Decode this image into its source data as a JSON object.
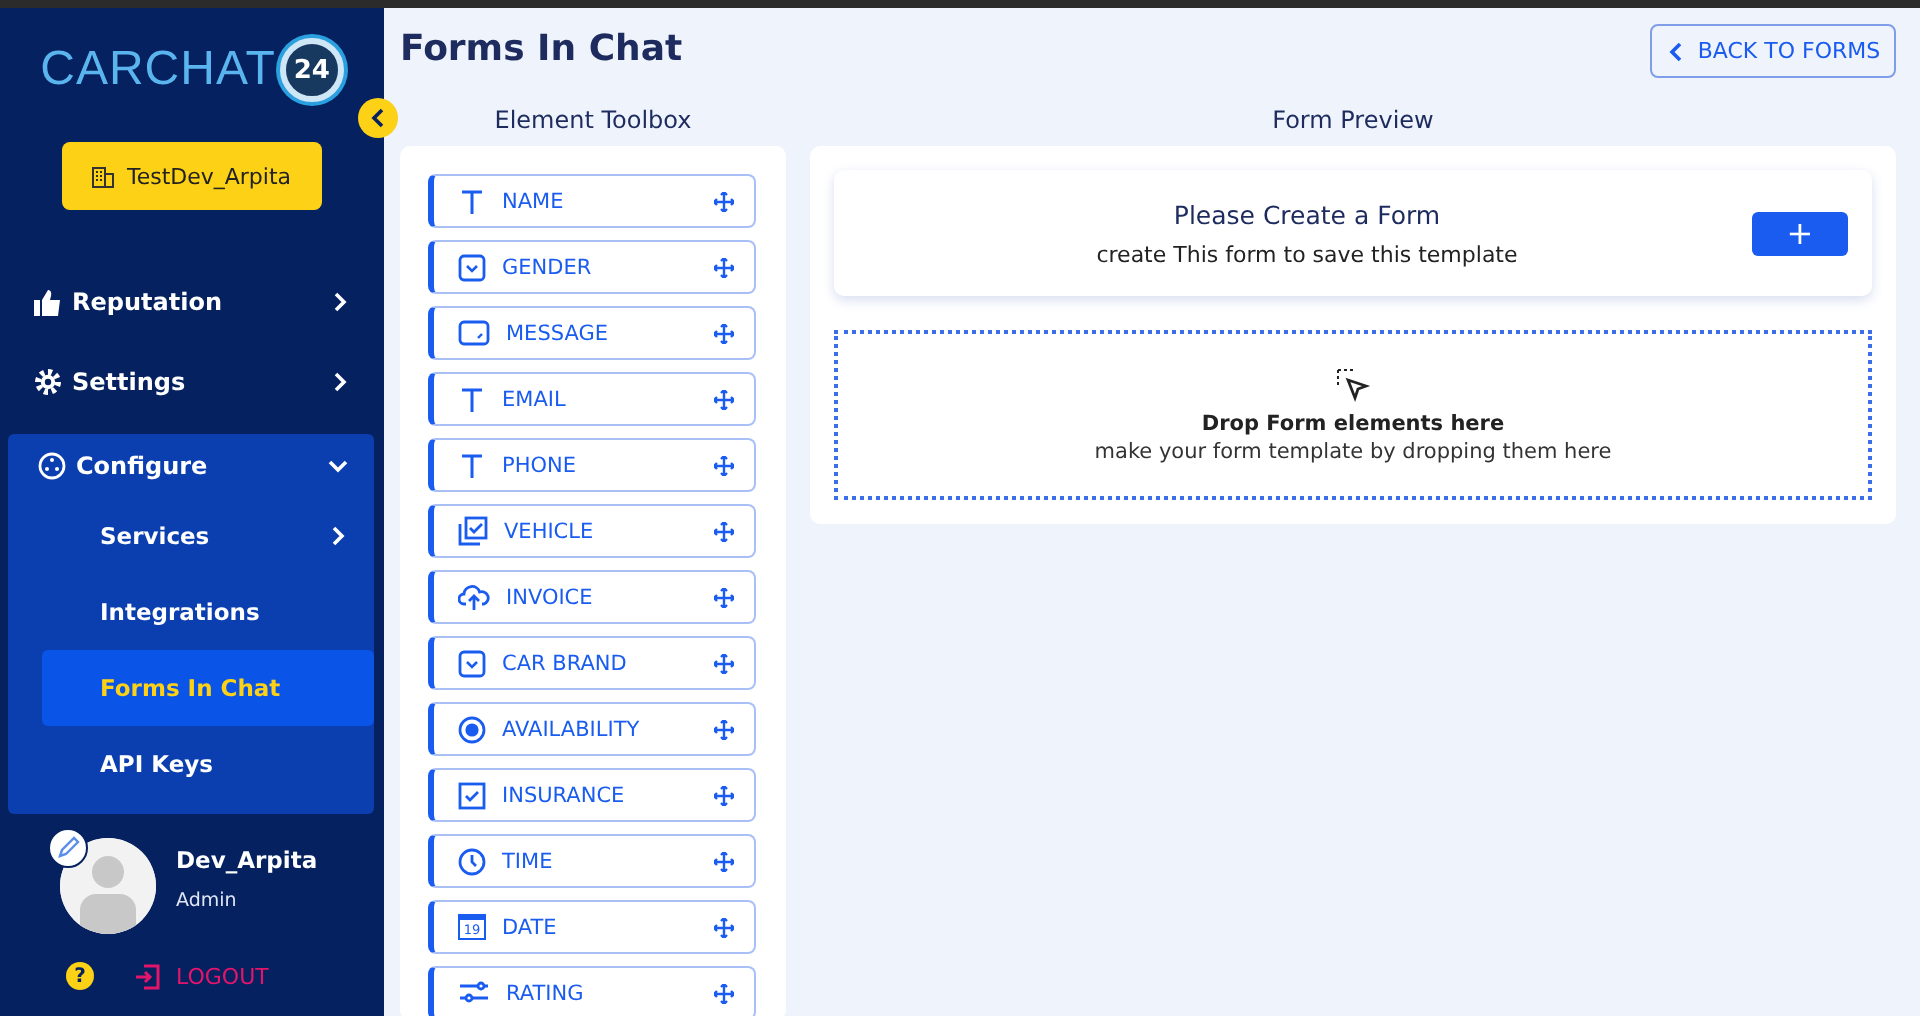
{
  "sidebar": {
    "logo": {
      "text": "CARCHAT",
      "badge": "24"
    },
    "workspace": "TestDev_Arpita",
    "menu": [
      {
        "label": "Reputation",
        "kind": "thumb",
        "expanded": false
      },
      {
        "label": "Settings",
        "kind": "gear",
        "expanded": false
      },
      {
        "label": "Configure",
        "kind": "network",
        "expanded": true,
        "children": [
          {
            "label": "Services",
            "expanded": false,
            "selected": false
          },
          {
            "label": "Integrations",
            "selected": false
          },
          {
            "label": "Forms In Chat",
            "selected": true
          },
          {
            "label": "API Keys",
            "selected": false
          }
        ]
      }
    ],
    "user": {
      "name": "Dev_Arpita",
      "role": "Admin"
    },
    "help": "?",
    "logout": "LOGOUT"
  },
  "page": {
    "title": "Forms In Chat",
    "back_button": "BACK TO FORMS"
  },
  "toolbox": {
    "title": "Element Toolbox",
    "items": [
      {
        "label": "NAME",
        "kind": "text"
      },
      {
        "label": "GENDER",
        "kind": "dropdown"
      },
      {
        "label": "MESSAGE",
        "kind": "textarea"
      },
      {
        "label": "EMAIL",
        "kind": "text"
      },
      {
        "label": "PHONE",
        "kind": "text"
      },
      {
        "label": "VEHICLE",
        "kind": "multicheck"
      },
      {
        "label": "INVOICE",
        "kind": "upload"
      },
      {
        "label": "CAR BRAND",
        "kind": "dropdown"
      },
      {
        "label": "AVAILABILITY",
        "kind": "radio"
      },
      {
        "label": "INSURANCE",
        "kind": "checkbox"
      },
      {
        "label": "TIME",
        "kind": "time"
      },
      {
        "label": "DATE",
        "kind": "date",
        "icon_text": "19"
      },
      {
        "label": "RATING",
        "kind": "rating"
      }
    ]
  },
  "preview": {
    "title": "Form Preview",
    "create_title": "Please Create a Form",
    "create_text": "create This form to save this template",
    "add_button": "+",
    "drop_title": "Drop Form elements here",
    "drop_text": "make your form template by dropping them here"
  }
}
